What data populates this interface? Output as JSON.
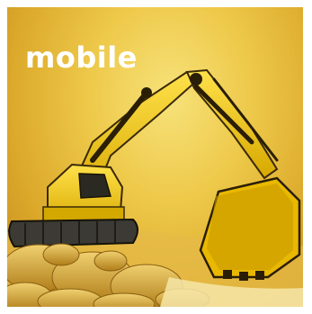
{
  "banner": {
    "headline": "mobile",
    "subject_icon": "excavator-photo",
    "colors": {
      "sky": "#eec94a",
      "machine_yellow": "#f2c400",
      "shadow": "#3a2a08",
      "headline_text": "#ffffff"
    }
  }
}
